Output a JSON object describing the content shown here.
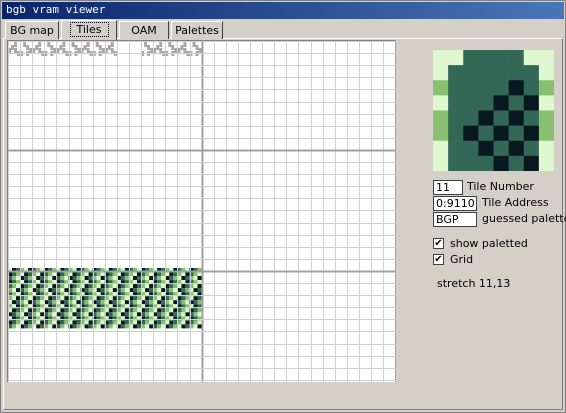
{
  "window": {
    "title": "bgb vram viewer"
  },
  "tabs": [
    {
      "label": "BG map",
      "active": false
    },
    {
      "label": "Tiles",
      "active": true
    },
    {
      "label": "OAM",
      "active": false
    },
    {
      "label": "Palettes",
      "active": false
    }
  ],
  "tile_info": {
    "tile_number": "11",
    "tile_number_label": "Tile Number",
    "tile_address": "0:9110",
    "tile_address_label": "Tile Address",
    "palette": "BGP",
    "palette_label": "guessed palette"
  },
  "options": {
    "show_paletted_label": "show paletted",
    "show_paletted_checked": true,
    "grid_label": "Grid",
    "grid_checked": true
  },
  "stretch_text": "stretch 11,13",
  "colors": {
    "shade0": "#e0f8d0",
    "shade1": "#88c070",
    "shade2": "#346856",
    "shade3": "#081820",
    "accent": "#0a246a"
  }
}
